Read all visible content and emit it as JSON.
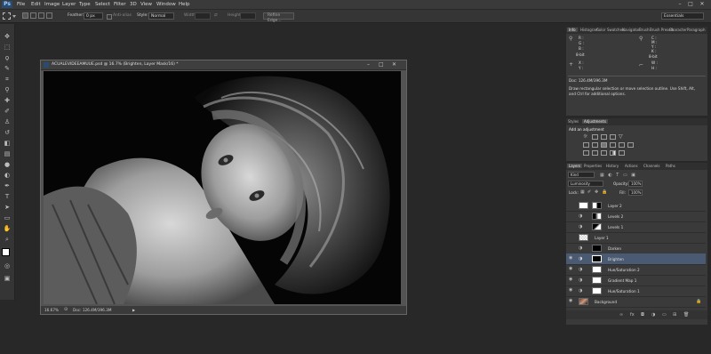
{
  "menu": {
    "logo": "Ps",
    "items": [
      "File",
      "Edit",
      "Image",
      "Layer",
      "Type",
      "Select",
      "Filter",
      "3D",
      "View",
      "Window",
      "Help"
    ]
  },
  "window_controls": {
    "minimize": "–",
    "maximize": "□",
    "close": "✕"
  },
  "options_bar": {
    "feather_label": "Feather:",
    "feather_value": "0 px",
    "antialias_label": "Anti-alias",
    "style_label": "Style:",
    "style_value": "Normal",
    "width_label": "Width:",
    "height_label": "Height:",
    "refine_edge": "Refine Edge...",
    "workspace": "Essentials"
  },
  "document": {
    "title": "ACUALEVIDEEAMUUE.psd @ 16.7% (Brighten, Layer Mask/16) *",
    "zoom": "16.67%",
    "doc_size": "Doc: 126.4M/396.3M"
  },
  "info_panel": {
    "tabs": [
      "Info",
      "Histogram",
      "Color",
      "Swatches",
      "Navigator",
      "Brush",
      "Brush Presets",
      "Character",
      "Paragraph"
    ],
    "left_block": [
      "R :",
      "G :",
      "B :",
      "8-bit"
    ],
    "right_block": [
      "C :",
      "M :",
      "Y :",
      "K :",
      "8-bit"
    ],
    "x_label": "X :",
    "y_label": "Y :",
    "w_label": "W :",
    "h_label": "H :",
    "doc": "Doc: 126.4M/396.3M",
    "hint": "Draw rectangular selection or move selection outline.  Use Shift, Alt, and Ctrl for additional options."
  },
  "adjustments_panel": {
    "tabs": [
      "Styles",
      "Adjustments"
    ],
    "title": "Add an adjustment"
  },
  "layers_panel": {
    "tabs": [
      "Layers",
      "Properties",
      "History",
      "Actions",
      "Channels",
      "Paths"
    ],
    "kind": "Kind",
    "blend_mode": "Luminosity",
    "opacity_label": "Opacity:",
    "opacity_value": "100%",
    "lock_label": "Lock:",
    "fill_label": "Fill:",
    "fill_value": "100%",
    "layers": [
      {
        "name": "Layer 2",
        "type": "mask"
      },
      {
        "name": "Levels 2",
        "type": "mask"
      },
      {
        "name": "Levels 1",
        "type": "mask"
      },
      {
        "name": "Layer 1",
        "type": "checker"
      },
      {
        "name": "Darken",
        "type": "black"
      },
      {
        "name": "Brighten",
        "type": "black",
        "selected": true
      },
      {
        "name": "Hue/Saturation 2",
        "type": "white"
      },
      {
        "name": "Gradient Map 1",
        "type": "white"
      },
      {
        "name": "Hue/Saturation 1",
        "type": "white"
      },
      {
        "name": "Background",
        "type": "photo"
      }
    ]
  },
  "colors": {
    "app_bg": "#282828",
    "panel_bg": "#3a3a3a",
    "selected_layer": "#4b5a73"
  }
}
